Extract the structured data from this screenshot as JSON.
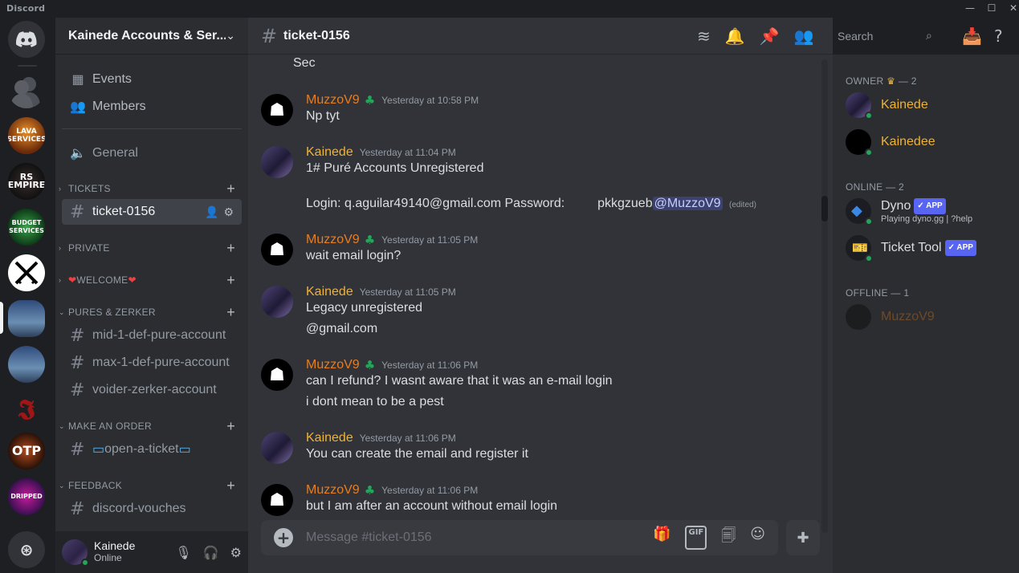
{
  "window": {
    "app_title": "Discord"
  },
  "servers": [
    {
      "name": "Home",
      "label": ""
    },
    {
      "name": "server-friends",
      "label": ""
    },
    {
      "name": "Lava Services",
      "label": "LAVA\nSERVICES"
    },
    {
      "name": "RS Empire",
      "label": "RS\nEMPIRE"
    },
    {
      "name": "Budget Services",
      "label": "BUDGET\nSERVICES"
    },
    {
      "name": "Swords",
      "label": ""
    },
    {
      "name": "Server 1",
      "label": ""
    },
    {
      "name": "Server 2",
      "label": ""
    },
    {
      "name": "Server L",
      "label": ""
    },
    {
      "name": "OTP",
      "label": "OTP"
    },
    {
      "name": "Dripped",
      "label": "DRIPPED"
    },
    {
      "name": "Discover",
      "label": ""
    }
  ],
  "sidebar": {
    "server_name": "Kainede Accounts & Ser...",
    "events": "Events",
    "members": "Members",
    "general": "General",
    "categories": {
      "tickets": "TICKETS",
      "private": "PRIVATE",
      "welcome": "WELCOME",
      "pures": "PURES & ZERKER",
      "order": "MAKE AN ORDER",
      "feedback": "FEEDBACK"
    },
    "channels": {
      "ticket": "ticket-0156",
      "mid": "mid-1-def-pure-account",
      "max": "max-1-def-pure-account",
      "voider": "voider-zerker-account",
      "open": "open-a-ticket",
      "vouches": "discord-vouches"
    }
  },
  "user": {
    "name": "Kainede",
    "status": "Online"
  },
  "chat": {
    "channel": "ticket-0156",
    "search_placeholder": "Search",
    "composer_placeholder": "Message #ticket-0156",
    "gif_label": "GIF",
    "messages": [
      {
        "text": "Sec"
      },
      {
        "author": "MuzzoV9",
        "ts": "Yesterday at 10:58 PM",
        "lines": [
          "Np tyt"
        ]
      },
      {
        "author": "Kainede",
        "ts": "Yesterday at 11:04 PM",
        "lines": [
          "1# Puré Accounts Unregistered",
          "Login: q.aguilar49140@gmail.com Password:"
        ],
        "pw": "pkkgzueb",
        "mention": "@MuzzoV9",
        "edited": "(edited)"
      },
      {
        "author": "MuzzoV9",
        "ts": "Yesterday at 11:05 PM",
        "lines": [
          "wait email login?"
        ]
      },
      {
        "author": "Kainede",
        "ts": "Yesterday at 11:05 PM",
        "lines": [
          "Legacy unregistered",
          "@gmail.com"
        ]
      },
      {
        "author": "MuzzoV9",
        "ts": "Yesterday at 11:06 PM",
        "lines": [
          "can I refund? I wasnt aware that it was an e-mail login",
          "i dont mean to be a pest"
        ]
      },
      {
        "author": "Kainede",
        "ts": "Yesterday at 11:06 PM",
        "lines": [
          "You can create the email and register it"
        ]
      },
      {
        "author": "MuzzoV9",
        "ts": "Yesterday at 11:06 PM",
        "lines": [
          "but I am after an account without email login"
        ]
      }
    ]
  },
  "members": {
    "owner_group": "OWNER",
    "owner_count": "— 2",
    "online_group": "ONLINE — 2",
    "offline_group": "OFFLINE — 1",
    "list": [
      {
        "name": "Kainede"
      },
      {
        "name": "Kainedee"
      },
      {
        "name": "Dyno",
        "tag": "APP",
        "sub": "Playing dyno.gg | ?help"
      },
      {
        "name": "Ticket Tool",
        "tag": "APP"
      },
      {
        "name": "MuzzoV9"
      }
    ]
  },
  "colors": {
    "kainede": "#f0b232",
    "muzzo": "#e67e22",
    "accent": "#5865f2",
    "online": "#23a55a"
  }
}
